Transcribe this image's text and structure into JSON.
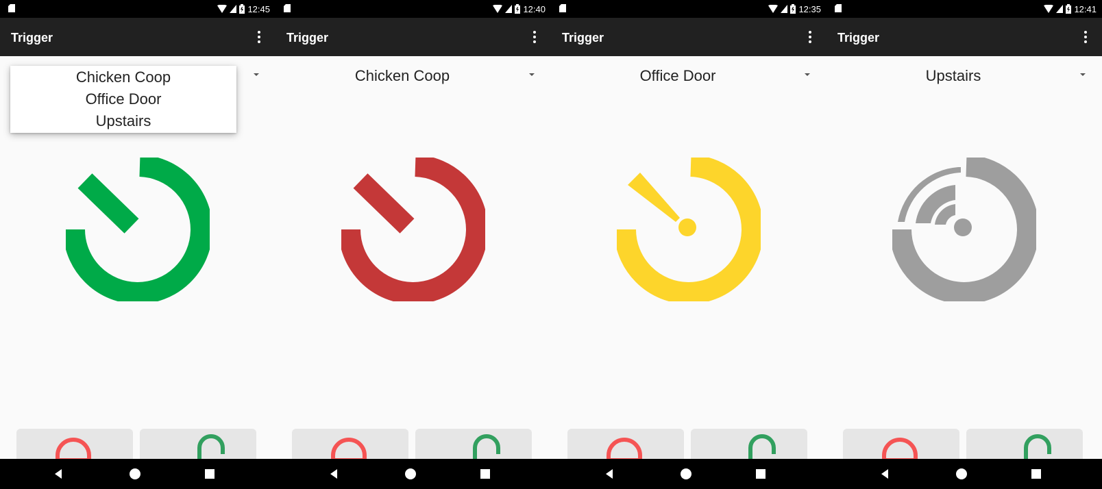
{
  "screens": [
    {
      "time": "12:45",
      "title": "Trigger",
      "selected": "",
      "dropdown_open": true,
      "options": [
        "Chicken Coop",
        "Office Door",
        "Upstairs"
      ],
      "status_color": "#00aa48",
      "status_icon": "timer-icon"
    },
    {
      "time": "12:40",
      "title": "Trigger",
      "selected": "Chicken Coop",
      "dropdown_open": false,
      "status_color": "#c43838",
      "status_icon": "timer-icon"
    },
    {
      "time": "12:35",
      "title": "Trigger",
      "selected": "Office Door",
      "dropdown_open": false,
      "status_color": "#fdd52b",
      "status_icon": "timer-pending-icon"
    },
    {
      "time": "12:41",
      "title": "Trigger",
      "selected": "Upstairs",
      "dropdown_open": false,
      "status_color": "#9e9e9e",
      "status_icon": "signal-icon"
    }
  ],
  "colors": {
    "lock": "#f55454",
    "unlock": "#32a05f"
  }
}
